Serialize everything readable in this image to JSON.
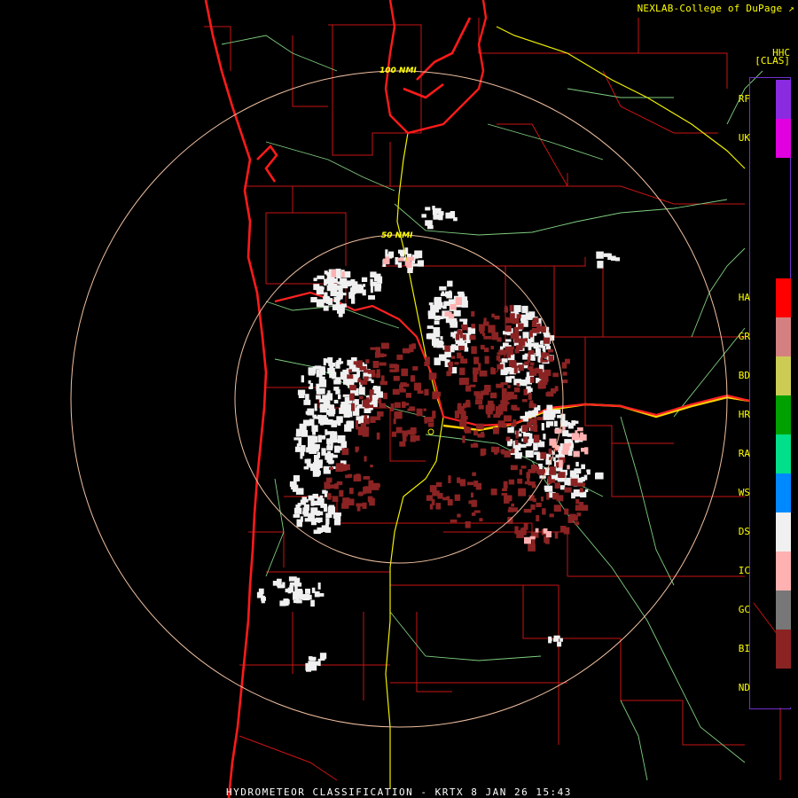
{
  "header": {
    "credit": "NEXLAB-College of DuPage",
    "credit_icon": "external-link-icon",
    "product_code": "HHC",
    "scale_tag": "[CLAS]"
  },
  "range_rings": {
    "inner_label": "50 NMI",
    "outer_label": "100 NMI"
  },
  "legend": [
    {
      "code": "RF",
      "color": "#8a2be2"
    },
    {
      "code": "UK",
      "color": "#e000e0"
    },
    {
      "code": "HA",
      "color": "#ff0000"
    },
    {
      "code": "GR",
      "color": "#d58080"
    },
    {
      "code": "BD",
      "color": "#cccc55"
    },
    {
      "code": "HR",
      "color": "#00a000"
    },
    {
      "code": "RA",
      "color": "#00e08a"
    },
    {
      "code": "WS",
      "color": "#0088ff"
    },
    {
      "code": "DS",
      "color": "#f0f0f0"
    },
    {
      "code": "IC",
      "color": "#ffb0b0"
    },
    {
      "code": "GC",
      "color": "#777777"
    },
    {
      "code": "BI",
      "color": "#8b2323"
    },
    {
      "code": "ND",
      "color": "#000000"
    }
  ],
  "footer": {
    "title": "HYDROMETEOR CLASSIFICATION - KRTX 8 JAN 26 15:43"
  },
  "colors": {
    "dry_snow": "#f0f0f0",
    "biological": "#8b2323",
    "ice_crystals": "#ffb0b0",
    "border": "#cc1111",
    "coast": "#ff1a1a",
    "highway": "#ffff00",
    "ring": "#f0c0a0",
    "road": "#88dd88"
  }
}
